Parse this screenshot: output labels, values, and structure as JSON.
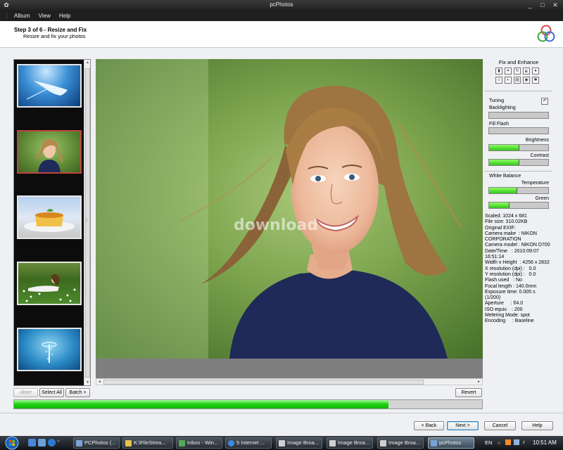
{
  "window": {
    "title": "pcPhotos"
  },
  "menu": [
    "Album",
    "View",
    "Help"
  ],
  "header": {
    "step": "Step 3 of 6 - Resize and Fix",
    "subtitle": "Resize and fix your photos"
  },
  "thumbnails": [
    {
      "name": "manta-ray-underwater",
      "selected": false
    },
    {
      "name": "girl-portrait",
      "selected": true
    },
    {
      "name": "creme-caramel-dessert",
      "selected": false
    },
    {
      "name": "girl-in-flower-field",
      "selected": false
    },
    {
      "name": "water-droplet-splash",
      "selected": false
    }
  ],
  "watermark": "download",
  "fix_panel": {
    "title": "Fix and Enhance",
    "icons": [
      "histogram-icon",
      "crop-icon",
      "rotate-icon",
      "levels-icon",
      "color-drop-icon",
      "portrait-icon",
      "contrast-icon",
      "filmstrip-icon",
      "red-eye-icon",
      "sharpen-icon"
    ],
    "tuning_label": "Tuning",
    "backlighting_label": "Backlighting",
    "fill_flash_label": "Fill Flash",
    "brightness_label": "Brightness",
    "contrast_label": "Contrast",
    "white_balance_label": "White Balance",
    "temperature_label": "Temperature",
    "green_label": "Green",
    "sliders": {
      "backlighting": 0,
      "fill_flash": 0,
      "brightness": 0.5,
      "contrast": 0.5,
      "temperature": 0.46,
      "green": 0.34
    }
  },
  "exif": {
    "scaled": "Scaled: 1024 x 681",
    "file_size": "File size: 310.02KB",
    "original": "Original EXIF:",
    "make": "Camera make  : NIKON",
    "make2": "CORPORATION",
    "model": "Camera model : NIKON D700",
    "datetime": "Date/Time   : 2010:09:07",
    "time": "16:51:14",
    "wh": "Width x Height  : 4256 x 2832",
    "xres": "X resolution (dpi) :   0.0",
    "yres": "Y resolution (dpi) :   0.0",
    "flash": "Flash used   : No",
    "focal": "Focal length : 140.0mm",
    "exposure": "Exposure time: 0.005 s",
    "exposure2": "(1/200)",
    "aperture": "Aperture     : f/4.0",
    "iso": "ISO equiv.   : 200",
    "metering": "Metering Mode: spot",
    "encoding": "Encoding     : Baseline"
  },
  "buttons": {
    "abort": "Abort",
    "select_all": "Select All",
    "batch": "Batch >",
    "revert": "Revert",
    "back": "< Back",
    "next": "Next >",
    "cancel": "Cancel",
    "help": "Help"
  },
  "progress": 0.8,
  "taskbar": {
    "tasks": [
      "PCPhotos (...",
      "K:\\FileStrea...",
      "Inbox - Win...",
      "5 Internet ...",
      "Image Broa...",
      "Image Broa...",
      "Image Broa...",
      "pcPhotos"
    ],
    "lang": "EN",
    "clock": "10:51 AM"
  }
}
